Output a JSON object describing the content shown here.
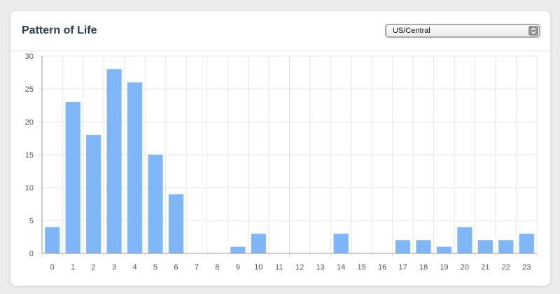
{
  "panel": {
    "title": "Pattern of Life",
    "timezone_select": {
      "selected": "US/Central",
      "icon": "updown-chevron-icon"
    }
  },
  "colors": {
    "bar": "#7eb6f8",
    "grid": "#e5e5e5",
    "axis": "#9a9a9a"
  },
  "chart_data": {
    "type": "bar",
    "categories": [
      "0",
      "1",
      "2",
      "3",
      "4",
      "5",
      "6",
      "7",
      "8",
      "9",
      "10",
      "11",
      "12",
      "13",
      "14",
      "15",
      "16",
      "17",
      "18",
      "19",
      "20",
      "21",
      "22",
      "23"
    ],
    "values": [
      4,
      23,
      18,
      28,
      26,
      15,
      9,
      0,
      0,
      1,
      3,
      0,
      0,
      0,
      3,
      0,
      0,
      2,
      2,
      1,
      4,
      2,
      2,
      3
    ],
    "ylim": [
      0,
      30
    ],
    "yticks": [
      0,
      5,
      10,
      15,
      20,
      25,
      30
    ],
    "grid": true,
    "legend": "none"
  }
}
